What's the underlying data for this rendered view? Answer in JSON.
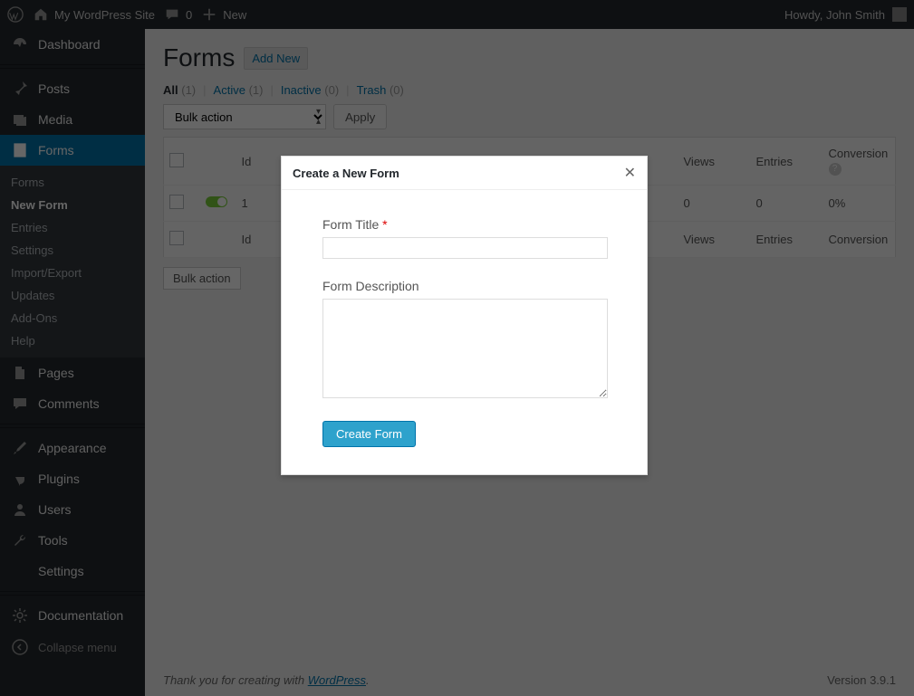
{
  "adminbar": {
    "site_name": "My WordPress Site",
    "comments": "0",
    "new": "New",
    "greeting": "Howdy,",
    "user": "John Smith"
  },
  "sidebar": {
    "dashboard": "Dashboard",
    "posts": "Posts",
    "media": "Media",
    "forms": "Forms",
    "pages": "Pages",
    "comments": "Comments",
    "appearance": "Appearance",
    "plugins": "Plugins",
    "users": "Users",
    "tools": "Tools",
    "settings": "Settings",
    "documentation": "Documentation",
    "collapse": "Collapse menu",
    "submenu": {
      "forms": "Forms",
      "new_form": "New Form",
      "entries": "Entries",
      "settings": "Settings",
      "import_export": "Import/Export",
      "updates": "Updates",
      "addons": "Add-Ons",
      "help": "Help"
    }
  },
  "page": {
    "title": "Forms",
    "add_new": "Add New"
  },
  "filters": {
    "all": "All",
    "all_count": "(1)",
    "active": "Active",
    "active_count": "(1)",
    "inactive": "Inactive",
    "inactive_count": "(0)",
    "trash": "Trash",
    "trash_count": "(0)"
  },
  "bulk": {
    "label": "Bulk action",
    "apply": "Apply"
  },
  "table": {
    "id": "Id",
    "views": "Views",
    "entries": "Entries",
    "conversion": "Conversion",
    "row": {
      "id": "1",
      "views": "0",
      "entries": "0",
      "conversion": "0%"
    }
  },
  "footer": {
    "thank": "Thank you for creating with ",
    "wp": "WordPress",
    "dot": ".",
    "version": "Version 3.9.1"
  },
  "modal": {
    "title": "Create a New Form",
    "form_title_label": "Form Title",
    "form_desc_label": "Form Description",
    "create": "Create Form"
  }
}
